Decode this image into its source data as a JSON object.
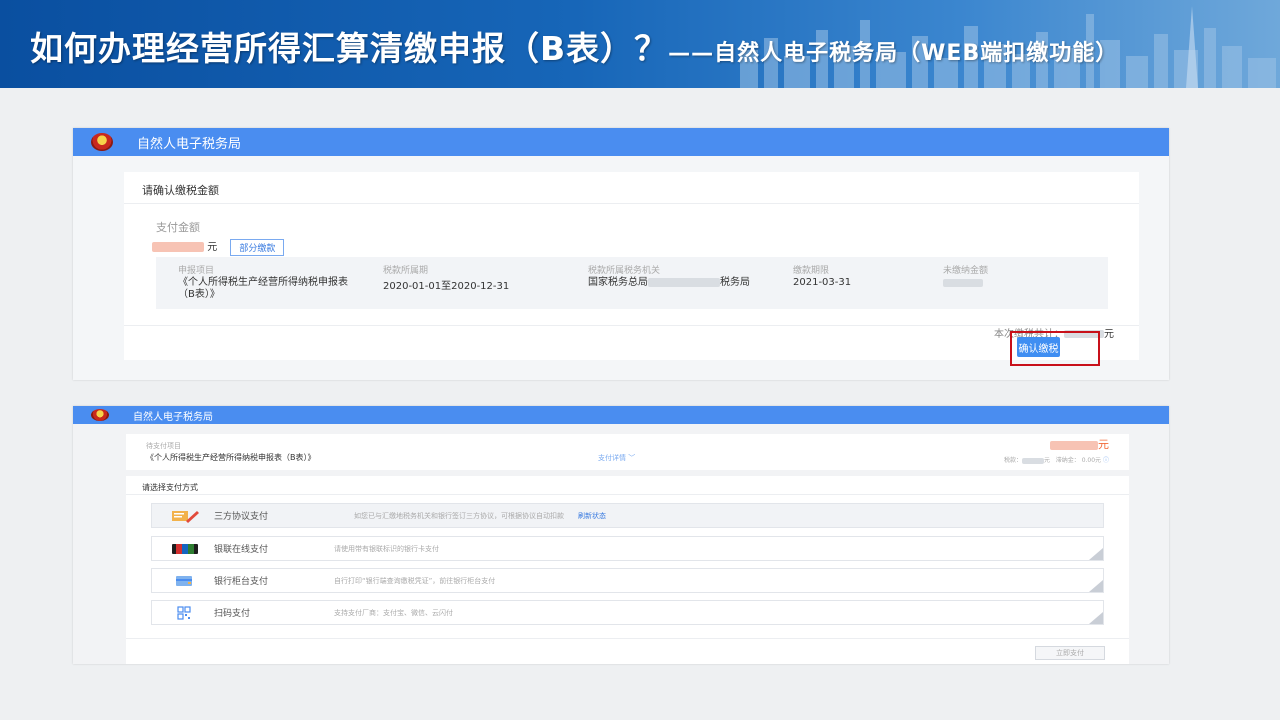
{
  "slide": {
    "title": "如何办理经营所得汇算清缴申报（B表）？",
    "subtitle": "——自然人电子税务局（WEB端扣缴功能）"
  },
  "top_screen": {
    "app_name": "自然人电子税务局",
    "section_title": "请确认缴税金额",
    "pay_amount_label": "支付金额",
    "currency_unit": "元",
    "partial_pay_label": "部分缴款",
    "table": {
      "headers": [
        "申报项目",
        "税款所属期",
        "税款所属税务机关",
        "缴款期限",
        "未缴纳金额"
      ],
      "row": [
        "《个人所得税生产经营所得纳税申报表（B表）》",
        "2020-01-01至2020-12-31",
        "国家税务总局",
        "2021-03-31",
        ""
      ],
      "office_suffix": "税务局"
    },
    "total_label": "本次缴税共计：",
    "confirm_button": "确认缴税"
  },
  "bottom_screen": {
    "app_name": "自然人电子税务局",
    "pending_label": "待支付项目",
    "pending_item": "《个人所得税生产经营所得纳税申报表（B表）》",
    "pay_detail_link": "支付详情",
    "amount_unit": "元",
    "tax_label": "税款：",
    "tax_unit": "元",
    "late_fee_label": "滞纳金：",
    "late_fee_value": "0.00元",
    "choose_method_title": "请选择支付方式",
    "methods": [
      {
        "name": "三方协议支付",
        "desc": "如您已与汇缴地税务机关和银行签订三方协议，可根据协议自动扣款",
        "link": "刷新状态"
      },
      {
        "name": "银联在线支付",
        "desc": "请使用带有银联标识的银行卡支付",
        "link": ""
      },
      {
        "name": "银行柜台支付",
        "desc": "自行打印“银行端查询缴税凭证”，前往银行柜台支付",
        "link": ""
      },
      {
        "name": "扫码支付",
        "desc": "支持支付厂商：支付宝、微信、云闪付",
        "link": ""
      }
    ],
    "pay_now_button": "立即支付"
  },
  "colors": {
    "header_blue": "#4a8df0",
    "button_blue": "#3f8ef2",
    "highlight_red": "#c8101a",
    "amount_orange": "#f26b3a"
  }
}
